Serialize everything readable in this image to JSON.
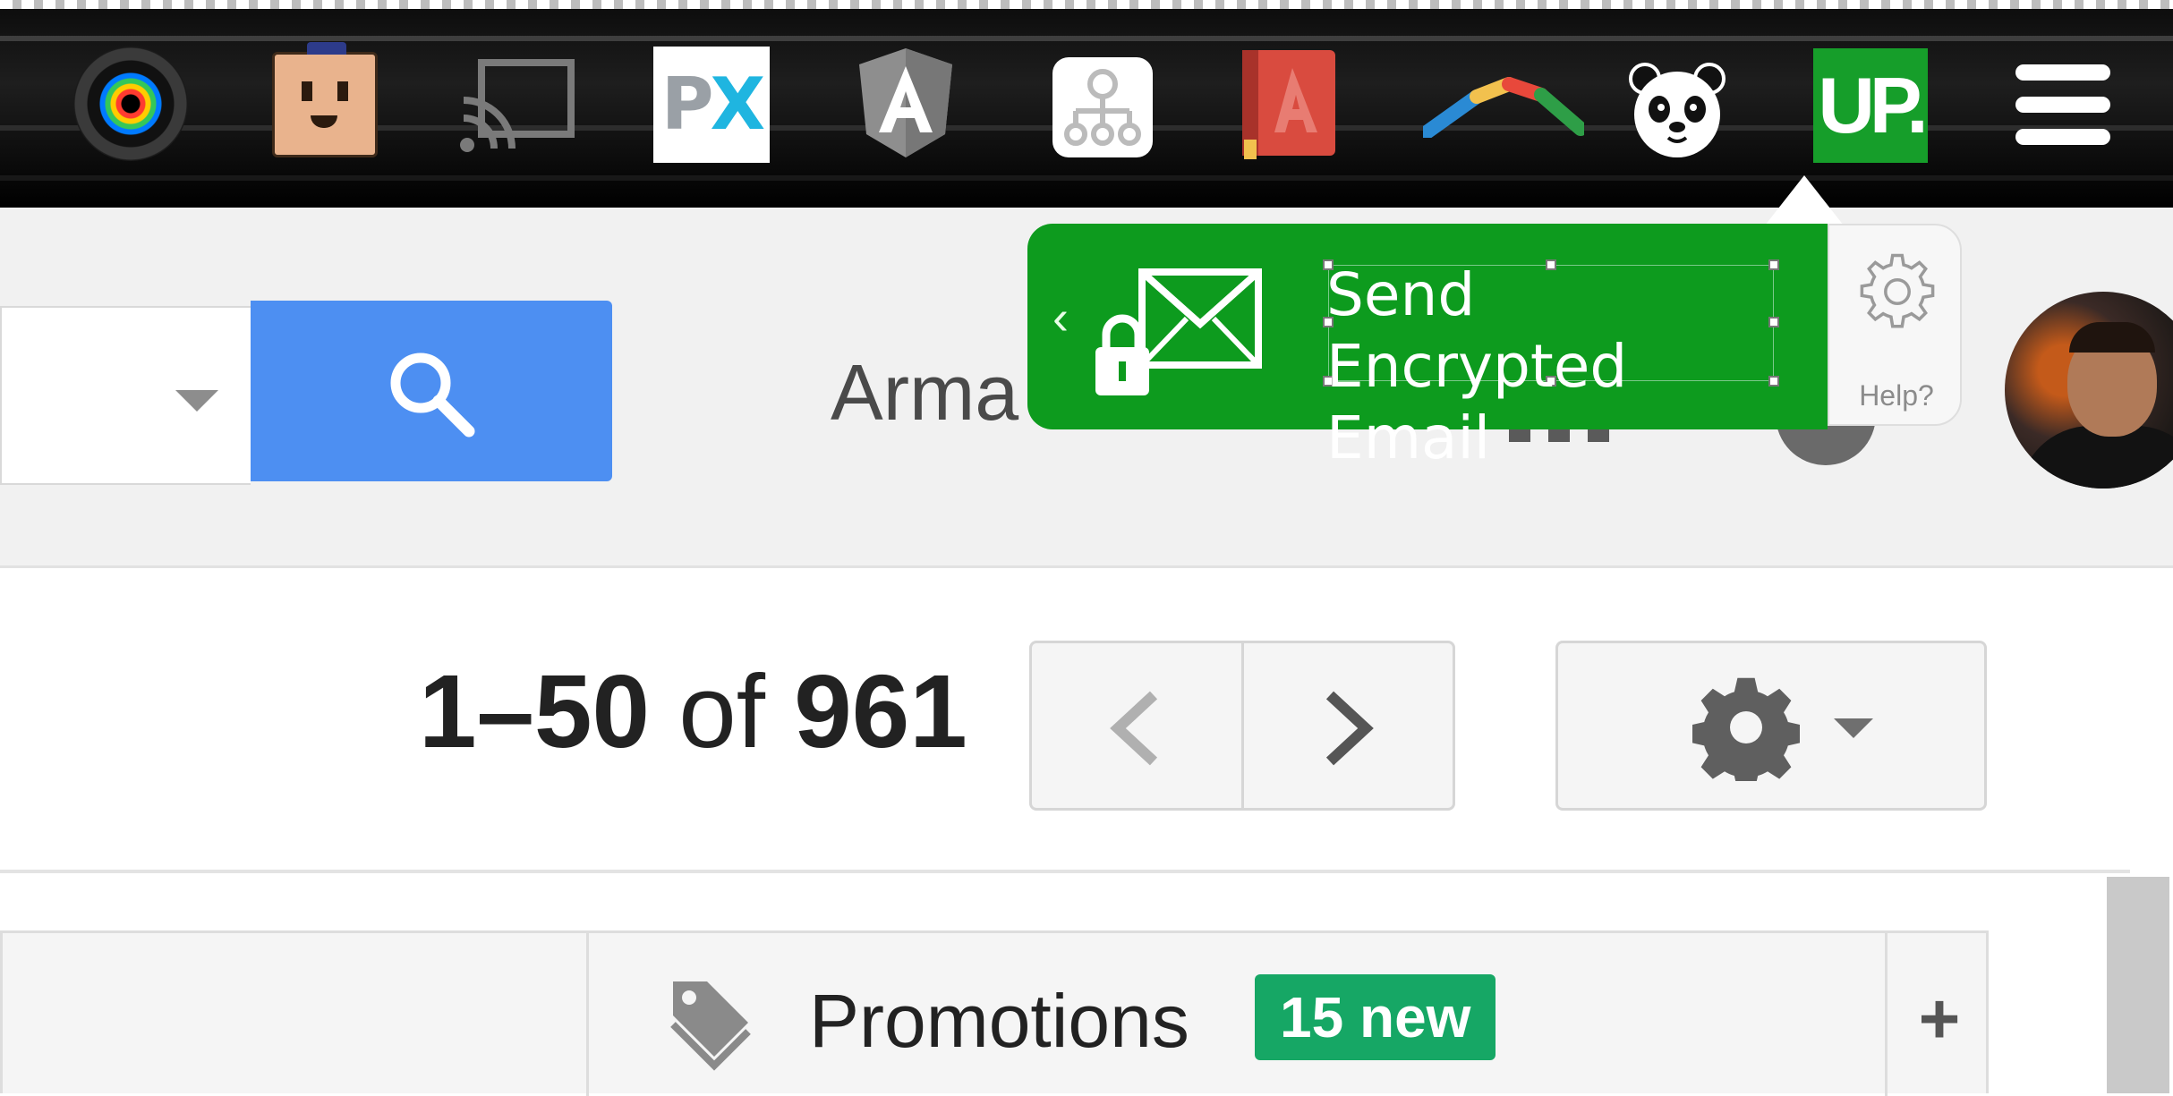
{
  "extensions": [
    {
      "name": "color-picker-camera-icon"
    },
    {
      "name": "power-outlet-icon"
    },
    {
      "name": "cast-icon"
    },
    {
      "name": "px-icon",
      "text": "PX"
    },
    {
      "name": "angular-icon"
    },
    {
      "name": "sitemap-icon"
    },
    {
      "name": "address-book-icon"
    },
    {
      "name": "boomerang-icon"
    },
    {
      "name": "panda-icon"
    },
    {
      "name": "up-icon",
      "text": "UP."
    },
    {
      "name": "chrome-menu-icon"
    }
  ],
  "header": {
    "user_name_partial": "Arma"
  },
  "encryption_popup": {
    "title": "Send Encrypted Email",
    "help_label": "Help?",
    "accent_color": "#0d9b1e"
  },
  "pagination": {
    "range": "1–50",
    "of_label": " of ",
    "total": "961"
  },
  "tabs": {
    "promotions_label": "Promotions",
    "promotions_badge": "15 new",
    "add_tab_label": "+"
  },
  "colors": {
    "search_button": "#4d8ff2",
    "badge": "#16a765"
  }
}
